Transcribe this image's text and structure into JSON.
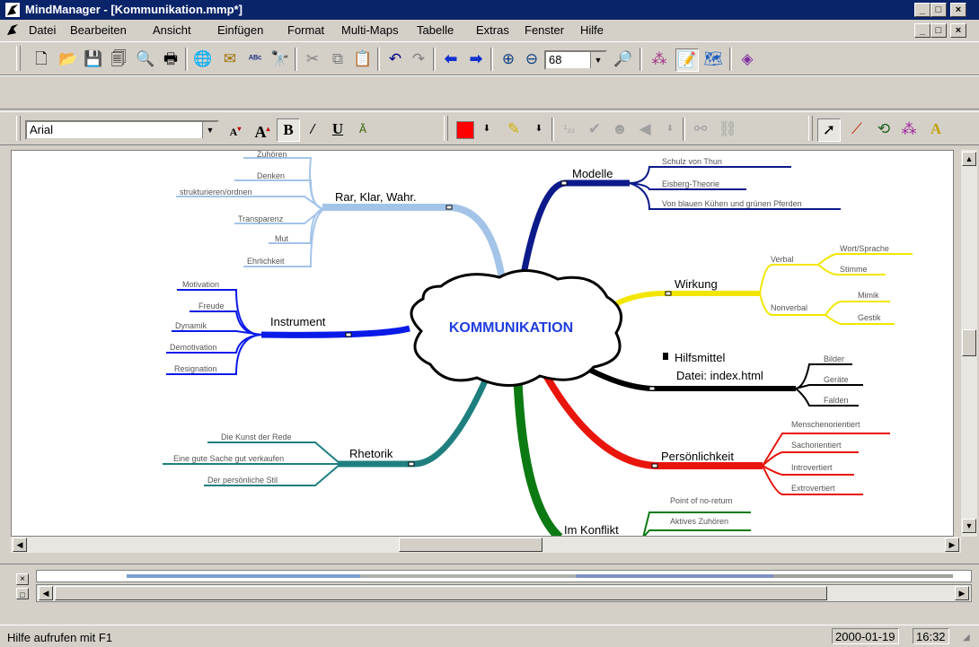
{
  "window": {
    "title": "MindManager - [Kommunikation.mmp*]",
    "min_glyph": "_",
    "max_glyph": "□",
    "close_glyph": "×"
  },
  "menu": [
    "Datei",
    "Bearbeiten",
    "Ansicht",
    "Einfügen",
    "Format",
    "Multi-Maps",
    "Tabelle",
    "Extras",
    "Fenster",
    "Hilfe"
  ],
  "format_toolbar": {
    "font": "Arial",
    "zoom": "68"
  },
  "map": {
    "central": "KOMMUNIKATION",
    "branches": {
      "rar": {
        "label": "Rar, Klar, Wahr.",
        "children": [
          "Zuhören",
          "Denken",
          "strukturieren/ordnen",
          "Transparenz",
          "Mut",
          "Ehrlichkeit"
        ]
      },
      "instrument": {
        "label": "Instrument",
        "children": [
          "Motivation",
          "Freude",
          "Dynamik",
          "Demotivation",
          "Resignation"
        ]
      },
      "rhetorik": {
        "label": "Rhetorik",
        "children": [
          "Die Kunst der Rede",
          "Eine gute Sache gut verkaufen",
          "Der persönliche Stil"
        ]
      },
      "modelle": {
        "label": "Modelle",
        "children": [
          "Schulz von Thun",
          "Eisberg-Theorie",
          "Von blauen Kühen und grünen Pferden"
        ]
      },
      "wirkung": {
        "label": "Wirkung",
        "verbal": "Verbal",
        "verbal_children": [
          "Wort/Sprache",
          "Stimme"
        ],
        "nonverbal": "Nonverbal",
        "nonverbal_children": [
          "Mimik",
          "Gestik"
        ]
      },
      "hilfsmittel": {
        "label1": "Hilfsmittel",
        "label2": "Datei: index.html",
        "children": [
          "Bilder",
          "Geräte",
          "Falden"
        ]
      },
      "persoenlichkeit": {
        "label": "Persönlichkeit",
        "children": [
          "Menschenorientiert",
          "Sachorientiert",
          "Introvertiert",
          "Extrovertiert"
        ]
      },
      "konflikt": {
        "label": "Im Konflikt",
        "children": [
          "Point of no-return",
          "Aktives Zuhören"
        ]
      }
    }
  },
  "colors": {
    "titlebar": "#0a246a",
    "rar": "#a3c4e8",
    "instrument": "#0a1ae8",
    "rhetorik": "#1f7f7f",
    "modelle": "#0c1a8a",
    "wirkung": "#f2e600",
    "hilfsmittel": "#000000",
    "persoenlichkeit": "#e8150c",
    "konflikt": "#0c7a12",
    "central_text": "#1f3de0"
  },
  "status": {
    "message": "Hilfe aufrufen mit F1",
    "date": "2000-01-19",
    "time": "16:32"
  }
}
